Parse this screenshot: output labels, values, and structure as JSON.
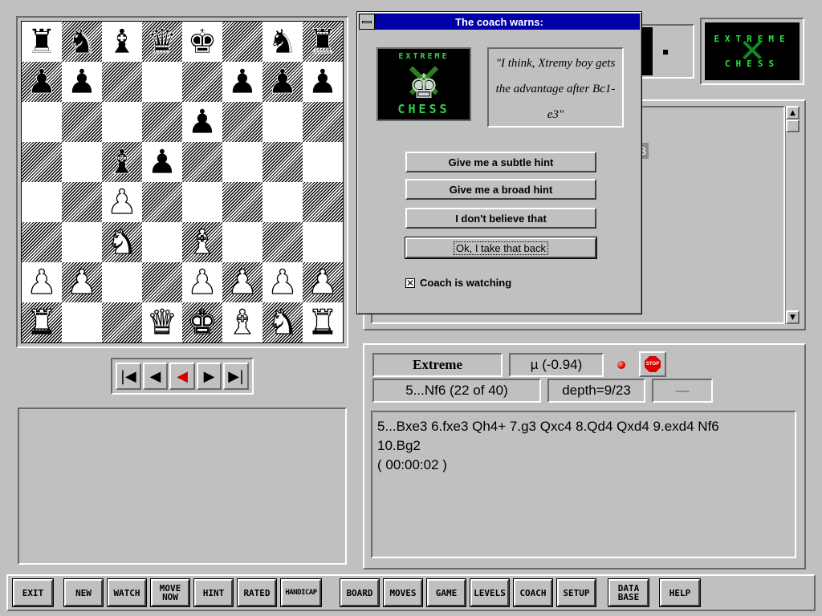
{
  "board": {
    "ranks": [
      [
        "b:rook",
        "b:knight",
        "b:bishop",
        "b:queen",
        "b:king",
        "",
        "b:knight",
        "b:rook"
      ],
      [
        "b:pawn",
        "b:pawn",
        "",
        "",
        "",
        "b:pawn",
        "b:pawn",
        "b:pawn"
      ],
      [
        "",
        "",
        "",
        "",
        "b:pawn",
        "",
        "",
        ""
      ],
      [
        "",
        "",
        "b:bishop",
        "b:pawn",
        "",
        "",
        "",
        ""
      ],
      [
        "",
        "",
        "w:pawn",
        "",
        "",
        "",
        "",
        ""
      ],
      [
        "",
        "",
        "w:knight",
        "",
        "w:bishop",
        "",
        "",
        ""
      ],
      [
        "w:pawn",
        "w:pawn",
        "",
        "",
        "w:pawn",
        "w:pawn",
        "w:pawn",
        "w:pawn"
      ],
      [
        "w:rook",
        "",
        "",
        "w:queen",
        "w:king",
        "w:bishop",
        "w:knight",
        "w:rook"
      ]
    ]
  },
  "glyphs": {
    "king": "♚",
    "queen": "♛",
    "rook": "♜",
    "bishop": "♝",
    "knight": "♞",
    "pawn": "♟"
  },
  "nav": {
    "first": "|◀",
    "back": "◀",
    "play": "◀",
    "forward": "▶",
    "last": "▶|"
  },
  "dialog": {
    "title": "The coach warns:",
    "logo_top": "EXTREME",
    "logo_bottom": "CHESS",
    "quote": "\"I think, Xtremy boy gets the advantage after Bc1-e3\"",
    "buttons": {
      "subtle": "Give me a subtle hint",
      "broad": "Give me a broad hint",
      "disbelieve": "I don't believe that",
      "takeback": "Ok, I take that back"
    },
    "watching_label": "Coach is watching",
    "watching_checked": "✕"
  },
  "logo": {
    "top": "EXTREME",
    "bottom": "CHESS"
  },
  "scrollbar": {
    "up": "▲",
    "down": "▼"
  },
  "hidden_fragment": "3",
  "analysis": {
    "engine": "Extreme",
    "score": "µ (-0.94)",
    "stop_label": "STOP",
    "move": "5...Nf6 (22 of 40)",
    "depth": "depth=9/23",
    "dash": "—",
    "pv_line1": "5...Bxe3 6.fxe3 Qh4+ 7.g3 Qxc4 8.Qd4 Qxd4 9.exd4 Nf6",
    "pv_line2": "10.Bg2",
    "pv_time": "( 00:00:02 )"
  },
  "toolbar": {
    "exit": "EXIT",
    "new": "NEW",
    "watch": "WATCH",
    "move_now_1": "MOVE",
    "move_now_2": "NOW",
    "hint": "HINT",
    "rated": "RATED",
    "handicap": "HANDICAP",
    "board": "BOARD",
    "moves": "MOVES",
    "game": "GAME",
    "levels": "LEVELS",
    "coach": "COACH",
    "setup": "SETUP",
    "database_1": "DATA",
    "database_2": "BASE",
    "help": "HELP"
  },
  "colors": {
    "title_bar": "#0000a8",
    "logo_green": "#1eea3c",
    "stop_red": "#e00000"
  }
}
